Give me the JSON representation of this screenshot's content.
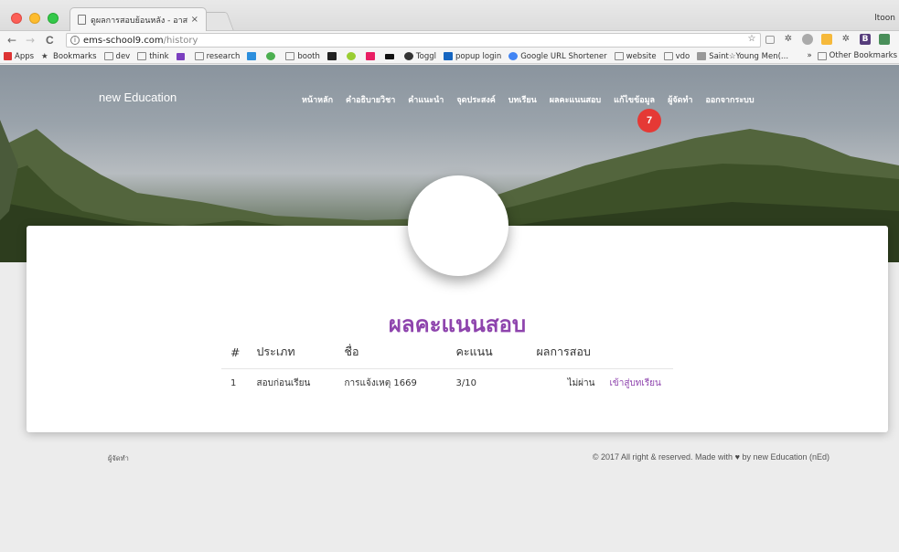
{
  "browser": {
    "tab_title": "ดูผลการสอบย้อนหลัง - อาสาจุกเบิ้ม",
    "tab_close": "×",
    "user": "ltoon",
    "nav": {
      "back": "←",
      "forward": "→",
      "reload": "C"
    },
    "url": {
      "domain": "ems-school9.com",
      "path": "/history"
    },
    "star": "☆",
    "bookmarks": [
      {
        "label": "Apps",
        "icon": "apps-icon"
      },
      {
        "label": "Bookmarks",
        "icon": "star-icon"
      },
      {
        "label": "dev",
        "icon": "folder-icon"
      },
      {
        "label": "think",
        "icon": "folder-icon"
      },
      {
        "label": "",
        "icon": "vue-icon"
      },
      {
        "label": "research",
        "icon": "folder-icon"
      },
      {
        "label": "",
        "icon": "trello-icon"
      },
      {
        "label": "",
        "icon": "leaf-icon"
      },
      {
        "label": "booth",
        "icon": "folder-icon"
      },
      {
        "label": "",
        "icon": "a-icon"
      },
      {
        "label": "",
        "icon": "m-icon"
      },
      {
        "label": "",
        "icon": "k-icon"
      },
      {
        "label": "",
        "icon": "bar-icon"
      },
      {
        "label": "Toggl",
        "icon": "toggl-icon"
      },
      {
        "label": "popup login",
        "icon": "h-icon"
      },
      {
        "label": "Google URL Shortener",
        "icon": "google-icon"
      },
      {
        "label": "website",
        "icon": "folder-icon"
      },
      {
        "label": "vdo",
        "icon": "folder-icon"
      },
      {
        "label": "Saint☆Young Men(...",
        "icon": "manga-icon"
      }
    ],
    "other_bookmarks": "Other Bookmarks",
    "overflow": "»"
  },
  "site": {
    "brand": "new Education",
    "menu": [
      "หน้าหลัก",
      "คำอธิบายวิชา",
      "คำแนะนำ",
      "จุดประสงค์",
      "บทเรียน",
      "ผลคะแนนสอบ",
      "แก้ไขข้อมูล",
      "ผู้จัดทำ",
      "ออกจากระบบ"
    ],
    "badge": "7"
  },
  "main": {
    "title": "ผลคะแนนสอบ",
    "table": {
      "headers": [
        "#",
        "ประเภท",
        "ชื่อ",
        "คะแนน",
        "ผลการสอบ",
        ""
      ],
      "rows": [
        {
          "num": "1",
          "type": "สอบก่อนเรียน",
          "name": "การแจ้งเหตุ 1669",
          "score": "3/10",
          "result": "ไม่ผ่าน",
          "action": "เข้าสู่บทเรียน"
        }
      ]
    }
  },
  "footer": {
    "left": "ผู้จัดทำ",
    "right_prefix": "© 2017 All right & reserved. Made with",
    "right_suffix": "by new Education (nEd)",
    "heart": "♥"
  },
  "colors": {
    "accent": "#8e44ad",
    "badge": "#e53935"
  }
}
